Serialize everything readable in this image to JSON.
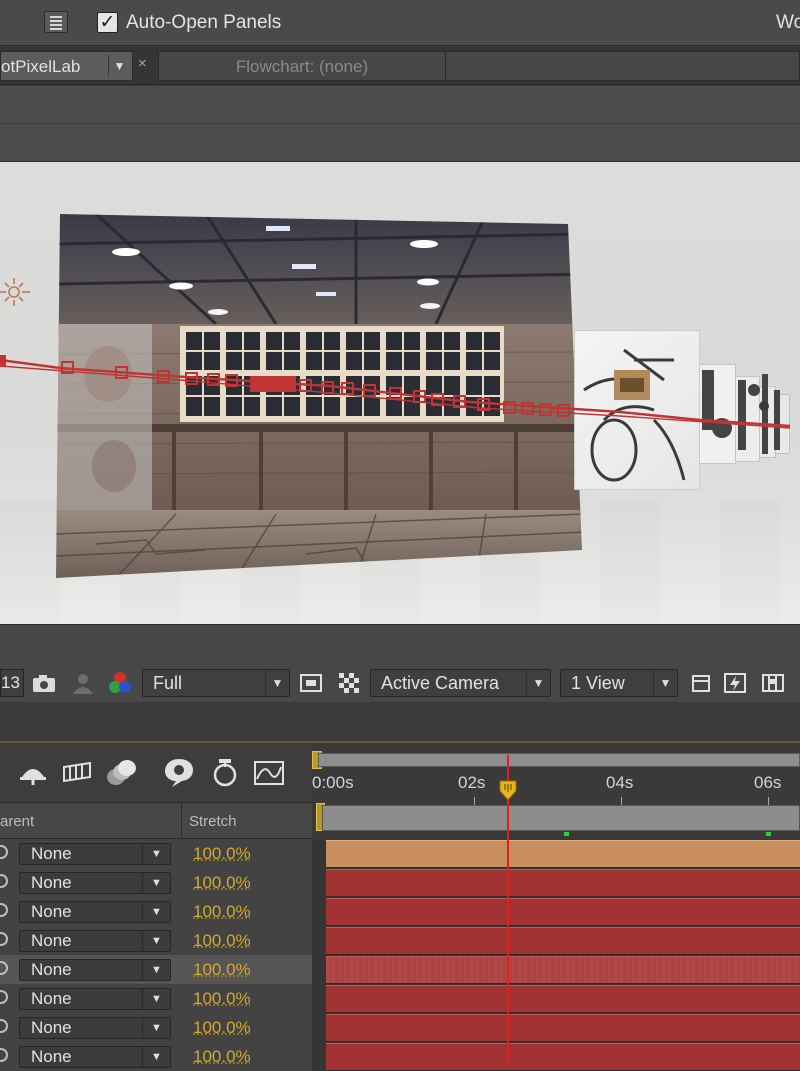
{
  "toolbar": {
    "auto_open_checked": true,
    "auto_open_label": "Auto-Open Panels",
    "workspace_label": "Wo"
  },
  "tabs": {
    "comp_tab": "otPixelLab",
    "flowchart": "Flowchart: (none)"
  },
  "viewer": {
    "zoom_fragment": "13",
    "resolution": "Full",
    "camera": "Active Camera",
    "view_layout": "1 View"
  },
  "timeline": {
    "ruler_labels": [
      "0:00s",
      "02s",
      "04s",
      "06s"
    ],
    "columns": {
      "parent": "arent",
      "stretch": "Stretch"
    },
    "layers": [
      {
        "parent": "None",
        "stretch": "100.0%"
      },
      {
        "parent": "None",
        "stretch": "100.0%"
      },
      {
        "parent": "None",
        "stretch": "100.0%"
      },
      {
        "parent": "None",
        "stretch": "100.0%"
      },
      {
        "parent": "None",
        "stretch": "100.0%"
      },
      {
        "parent": "None",
        "stretch": "100.0%"
      },
      {
        "parent": "None",
        "stretch": "100.0%"
      },
      {
        "parent": "None",
        "stretch": "100.0%"
      }
    ]
  },
  "colors": {
    "label_orange": "#c88e5e",
    "layer_red": "#a33232",
    "current_time_indicator": "#e21e1e",
    "stretch_value": "#d6a82e"
  }
}
